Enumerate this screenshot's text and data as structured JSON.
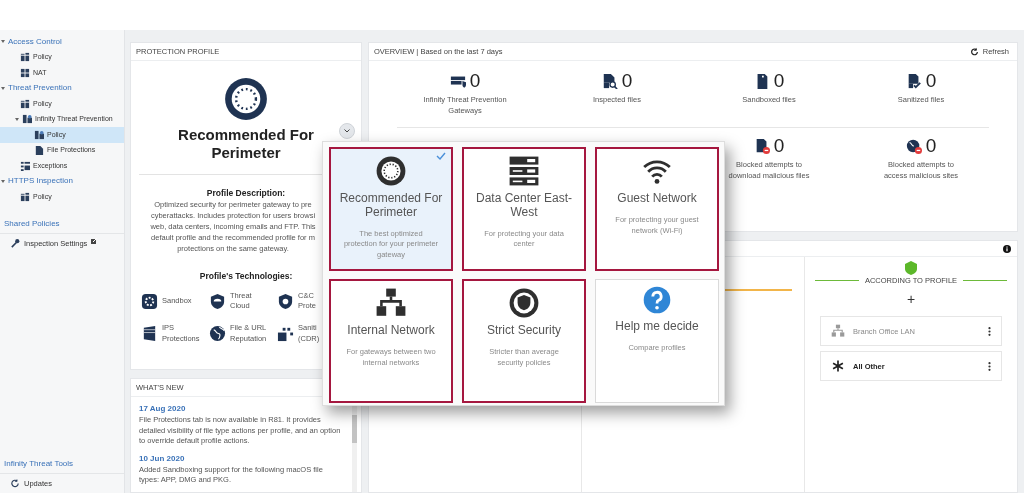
{
  "sidebar": {
    "tree": [
      {
        "label": "Access Control",
        "selected": false,
        "expanded": true,
        "children": [
          {
            "label": "Policy",
            "kind": "policy",
            "selected": false
          },
          {
            "label": "NAT",
            "kind": "nat",
            "selected": false
          }
        ]
      },
      {
        "label": "Threat Prevention",
        "selected": false,
        "expanded": true,
        "children": [
          {
            "label": "Policy",
            "kind": "policy",
            "selected": false
          },
          {
            "label": "Infinity Threat Prevention",
            "kind": "policy-group",
            "selected": false,
            "expanded": true,
            "children": [
              {
                "label": "Policy",
                "kind": "policy-group",
                "selected": true
              },
              {
                "label": "File Protections",
                "kind": "file",
                "selected": false
              }
            ]
          },
          {
            "label": "Exceptions",
            "kind": "exceptions",
            "selected": false
          }
        ]
      },
      {
        "label": "HTTPS Inspection",
        "selected": false,
        "expanded": true,
        "children": [
          {
            "label": "Policy",
            "kind": "policy",
            "selected": false
          }
        ]
      }
    ],
    "groups": [
      {
        "title": "Shared Policies",
        "items": [
          {
            "label": "Inspection Settings",
            "kind": "wrench",
            "external": true
          }
        ]
      },
      {
        "title": "Infinity Threat Tools",
        "items": [
          {
            "label": "Updates",
            "kind": "updates",
            "external": false
          }
        ]
      }
    ]
  },
  "profile": {
    "header": "PROTECTION PROFILE",
    "title": "Recommended For Perimeter",
    "description_heading": "Profile Description:",
    "description_lines": [
      "Optimized security for perimeter gateway to pre",
      "cyberattacks. Includes protection for users browsi",
      "web, data centers, incoming emails and FTP. This",
      "default profile and the recommended profile for m",
      "protections on the same gateway."
    ],
    "technologies_heading": "Profile's Technologies:",
    "technologies": [
      {
        "label": "Sandbox",
        "kind": "sandbox"
      },
      {
        "label": "Threat Cloud",
        "kind": "cloud"
      },
      {
        "label": "C&C Prote",
        "kind": "cnc"
      },
      {
        "label": "IPS Protections",
        "kind": "ips"
      },
      {
        "label": "File & URL Reputation",
        "kind": "globe"
      },
      {
        "label": "Saniti (CDR)",
        "kind": "cdr"
      }
    ]
  },
  "whats_new": {
    "header": "WHAT'S NEW",
    "entries": [
      {
        "date": "17 Aug 2020",
        "text": "File Protections tab is now available in R81. It provides detailed visibility of file type actions per profile, and an option to override default profile actions."
      },
      {
        "date": "10 Jun 2020",
        "text": "Added Sandboxing support for the following macOS file types: APP, DMG and PKG."
      }
    ]
  },
  "overview": {
    "header": "OVERVIEW | Based on the last 7 days",
    "refresh": "Refresh",
    "stats": [
      {
        "value": "0",
        "label": "Infinity Threat Prevention Gateways",
        "kind": "gateway"
      },
      {
        "value": "0",
        "label": "Inspected files",
        "kind": "inspect"
      },
      {
        "value": "0",
        "label": "Sandboxed files",
        "kind": "sandboxed"
      },
      {
        "value": "0",
        "label": "Sanitized files",
        "kind": "sanitized"
      }
    ],
    "blocked_stats": [
      {
        "value": "0",
        "label": "Blocked attempts to download malicious files",
        "kind": "blocked-file"
      },
      {
        "value": "0",
        "label": "Blocked attempts to access malicious sites",
        "kind": "blocked-site"
      }
    ]
  },
  "assignments": {
    "heading": "ACCORDING TO PROFILE",
    "add": "+",
    "items": [
      {
        "label": "Branch Office LAN",
        "kind": "network",
        "disabled": true
      },
      {
        "label": "All Other",
        "kind": "asterisk",
        "disabled": false
      }
    ]
  },
  "popup": {
    "tiles": [
      {
        "title": "Recommended For Perimeter",
        "description": "The best optimized protection for your perimeter gateway",
        "kind": "ring",
        "selected": true,
        "outlined": true
      },
      {
        "title": "Data Center East-West",
        "description": "For protecting your data center",
        "kind": "server",
        "selected": false,
        "outlined": true
      },
      {
        "title": "Guest Network",
        "description": "For protecting your guest network (Wi-Fi)",
        "kind": "wifi",
        "selected": false,
        "outlined": true
      },
      {
        "title": "Internal Network",
        "description": "For gateways between two internal networks",
        "kind": "network",
        "selected": false,
        "outlined": true
      },
      {
        "title": "Strict Security",
        "description": "Stricter than average security policies",
        "kind": "strict",
        "selected": false,
        "outlined": true
      },
      {
        "title": "Help me decide",
        "description": "Compare profiles",
        "kind": "help",
        "selected": false,
        "outlined": false
      }
    ]
  }
}
